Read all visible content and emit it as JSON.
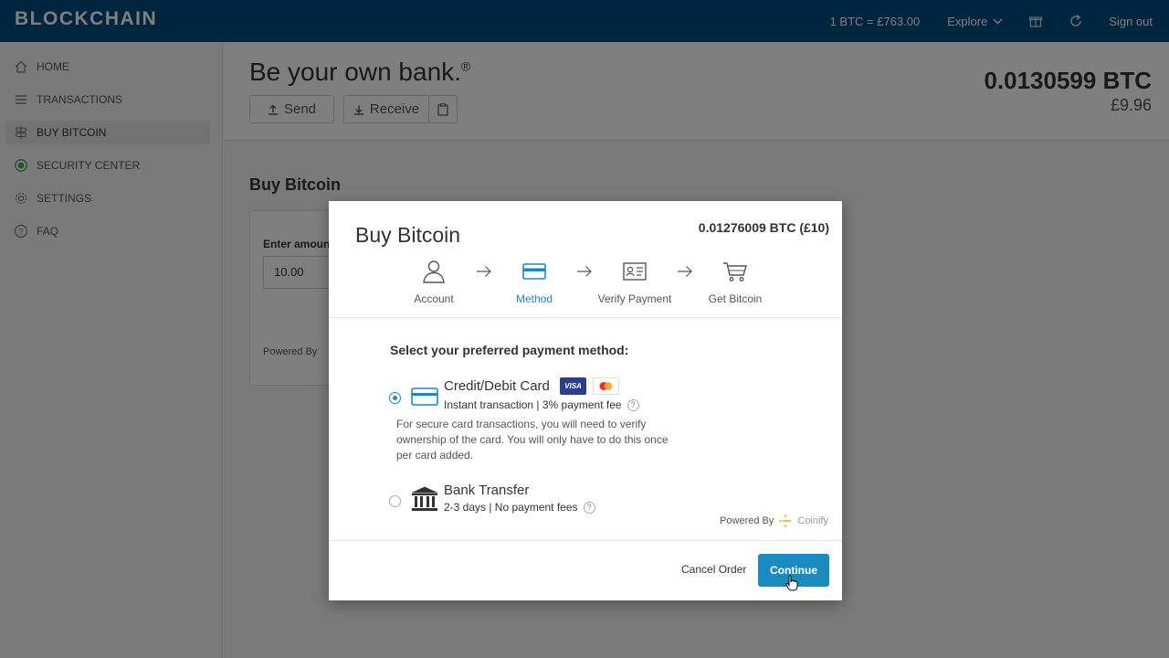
{
  "app": {
    "brand": "BLOCKCHAIN"
  },
  "topbar": {
    "rate": "1 BTC =  £763.00",
    "explore": "Explore",
    "sign_out": "Sign out"
  },
  "sidebar": {
    "items": [
      {
        "label": "HOME",
        "icon": "home-icon"
      },
      {
        "label": "TRANSACTIONS",
        "icon": "list-icon"
      },
      {
        "label": "BUY BITCOIN",
        "icon": "signpost-icon",
        "active": true
      },
      {
        "label": "SECURITY CENTER",
        "icon": "shield-icon"
      },
      {
        "label": "SETTINGS",
        "icon": "gear-icon"
      },
      {
        "label": "FAQ",
        "icon": "question-icon"
      }
    ]
  },
  "hero": {
    "title": "Be your own bank.",
    "title_mark": "®",
    "send_label": "Send",
    "receive_label": "Receive",
    "balance_btc": "0.0130599 BTC",
    "balance_fiat": "£9.96"
  },
  "page": {
    "section_title": "Buy Bitcoin",
    "amount_label": "Enter amount",
    "amount_value": "10.00",
    "powered_by": "Powered By"
  },
  "modal": {
    "title": "Buy Bitcoin",
    "btc_amount": "0.01276009 BTC (£10)",
    "steps": [
      {
        "label": "Account",
        "icon": "user-icon"
      },
      {
        "label": "Method",
        "icon": "credit-card-icon",
        "active": true
      },
      {
        "label": "Verify Payment",
        "icon": "id-card-icon"
      },
      {
        "label": "Get Bitcoin",
        "icon": "cart-icon"
      }
    ],
    "prompt": "Select your preferred payment method:",
    "options": {
      "card": {
        "name": "Credit/Debit Card",
        "sub": "Instant transaction | 3% payment fee",
        "desc": "For secure card transactions, you will need to verify ownership of the card. You will only have to do this once per card added.",
        "selected": true,
        "visa_label": "VISA"
      },
      "bank": {
        "name": "Bank Transfer",
        "sub": "2-3 days | No payment fees",
        "selected": false
      }
    },
    "powered_by": "Powered By",
    "coinify": "Coinify",
    "cancel_label": "Cancel Order",
    "continue_label": "Continue"
  },
  "colors": {
    "topbar": "#004a7c",
    "accent": "#1a8bbf"
  }
}
